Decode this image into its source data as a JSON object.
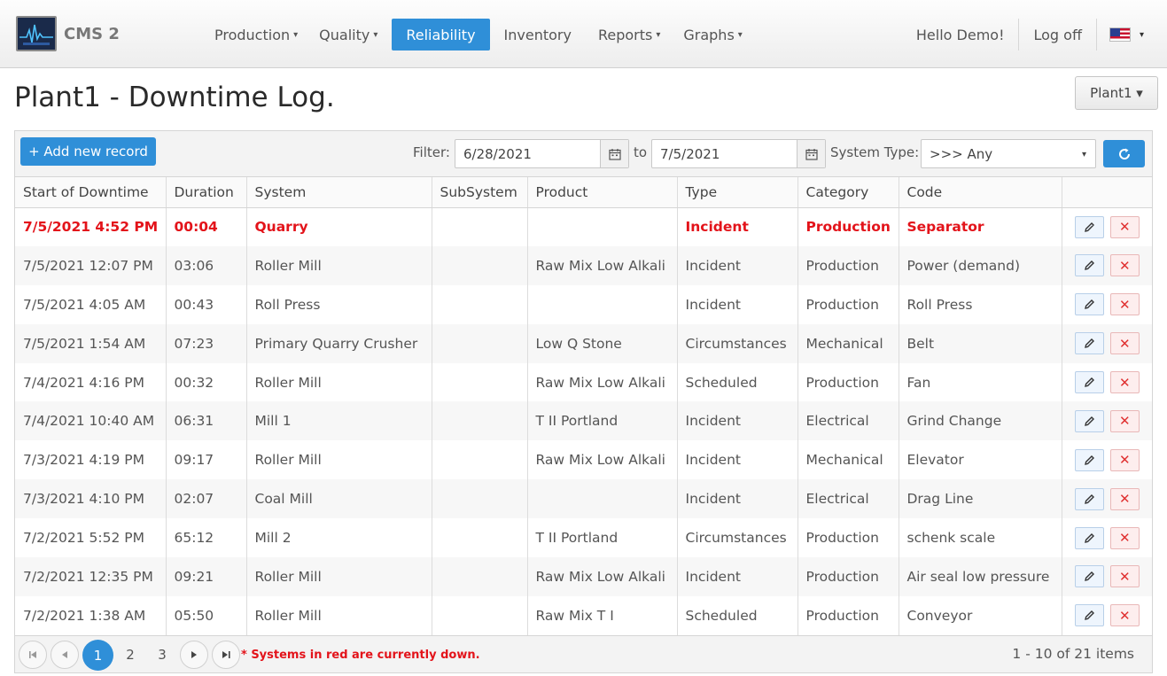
{
  "app": {
    "brand": "CMS 2"
  },
  "nav": {
    "items": [
      {
        "label": "Production",
        "caret": "▾"
      },
      {
        "label": "Quality",
        "caret": "▾"
      },
      {
        "label": "Reliability",
        "caret": ""
      },
      {
        "label": "Inventory",
        "caret": ""
      },
      {
        "label": "Reports",
        "caret": "▾"
      },
      {
        "label": "Graphs",
        "caret": "▾"
      }
    ],
    "greeting": "Hello Demo!",
    "logoff": "Log off",
    "lang_caret": "▾"
  },
  "page": {
    "title": "Plant1 - Downtime Log.",
    "plant_button": "Plant1 ▾"
  },
  "toolbar": {
    "add_label": "+ Add new record",
    "filter_label": "Filter:",
    "date_from": "6/28/2021",
    "to_label": "to",
    "date_to": "7/5/2021",
    "system_type_label": "System Type:",
    "system_type_value": ">>> Any",
    "select_arrow": "▾"
  },
  "table": {
    "columns": [
      "Start of Downtime",
      "Duration",
      "System",
      "SubSystem",
      "Product",
      "Type",
      "Category",
      "Code",
      ""
    ],
    "rows": [
      [
        "7/5/2021 4:52 PM",
        "00:04",
        "Quarry",
        "",
        "",
        "Incident",
        "Production",
        "Separator"
      ],
      [
        "7/5/2021 12:07 PM",
        "03:06",
        "Roller Mill",
        "",
        "Raw Mix Low Alkali",
        "Incident",
        "Production",
        "Power (demand)"
      ],
      [
        "7/5/2021 4:05 AM",
        "00:43",
        "Roll Press",
        "",
        "",
        "Incident",
        "Production",
        "Roll Press"
      ],
      [
        "7/5/2021 1:54 AM",
        "07:23",
        "Primary Quarry Crusher",
        "",
        "Low Q Stone",
        "Circumstances",
        "Mechanical",
        "Belt"
      ],
      [
        "7/4/2021 4:16 PM",
        "00:32",
        "Roller Mill",
        "",
        "Raw Mix Low Alkali",
        "Scheduled",
        "Production",
        "Fan"
      ],
      [
        "7/4/2021 10:40 AM",
        "06:31",
        "Mill 1",
        "",
        "T II Portland",
        "Incident",
        "Electrical",
        "Grind Change"
      ],
      [
        "7/3/2021 4:19 PM",
        "09:17",
        "Roller Mill",
        "",
        "Raw Mix Low Alkali",
        "Incident",
        "Mechanical",
        "Elevator"
      ],
      [
        "7/3/2021 4:10 PM",
        "02:07",
        "Coal Mill",
        "",
        "",
        "Incident",
        "Electrical",
        "Drag Line"
      ],
      [
        "7/2/2021 5:52 PM",
        "65:12",
        "Mill 2",
        "",
        "T II Portland",
        "Circumstances",
        "Production",
        "schenk scale"
      ],
      [
        "7/2/2021 12:35 PM",
        "09:21",
        "Roller Mill",
        "",
        "Raw Mix Low Alkali",
        "Incident",
        "Production",
        "Air seal low pressure"
      ],
      [
        "7/2/2021 1:38 AM",
        "05:50",
        "Roller Mill",
        "",
        "Raw Mix T I",
        "Scheduled",
        "Production",
        "Conveyor"
      ]
    ],
    "delete_glyph": "✕"
  },
  "pager": {
    "pages": [
      "1",
      "2",
      "3"
    ],
    "current": "1",
    "note": "* Systems in red are currently down.",
    "items_info": "1 - 10 of 21 items"
  },
  "colors": {
    "accent": "#2f8fd8",
    "down_red": "#e3131a"
  }
}
